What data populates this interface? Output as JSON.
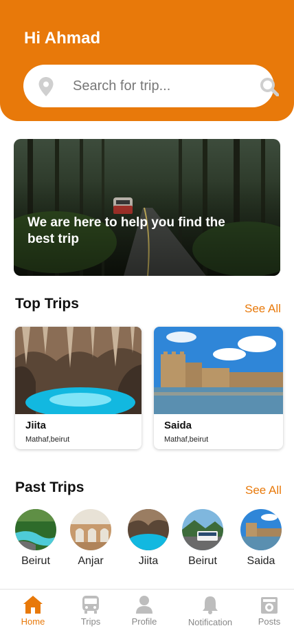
{
  "header": {
    "greeting": "Hi Ahmad",
    "search": {
      "placeholder": "Search for trip...",
      "value": ""
    }
  },
  "hero": {
    "text": "We are here to help you find the best trip"
  },
  "top_trips": {
    "title": "Top Trips",
    "see_all": "See All",
    "items": [
      {
        "name": "Jiita",
        "location": "Mathaf,beirut"
      },
      {
        "name": "Saida",
        "location": "Mathaf,beirut"
      }
    ]
  },
  "past_trips": {
    "title": "Past Trips",
    "see_all": "See All",
    "items": [
      {
        "label": "Beirut"
      },
      {
        "label": "Anjar"
      },
      {
        "label": "Jiita"
      },
      {
        "label": "Beirut"
      },
      {
        "label": "Saida"
      }
    ]
  },
  "nav": {
    "active": "Home",
    "items": [
      {
        "label": "Home",
        "icon": "home-icon"
      },
      {
        "label": "Trips",
        "icon": "bus-icon"
      },
      {
        "label": "Profile",
        "icon": "person-icon"
      },
      {
        "label": "Notification",
        "icon": "bell-icon"
      },
      {
        "label": "Posts",
        "icon": "posts-icon"
      }
    ]
  },
  "colors": {
    "accent": "#E8790A",
    "muted": "#888888"
  }
}
